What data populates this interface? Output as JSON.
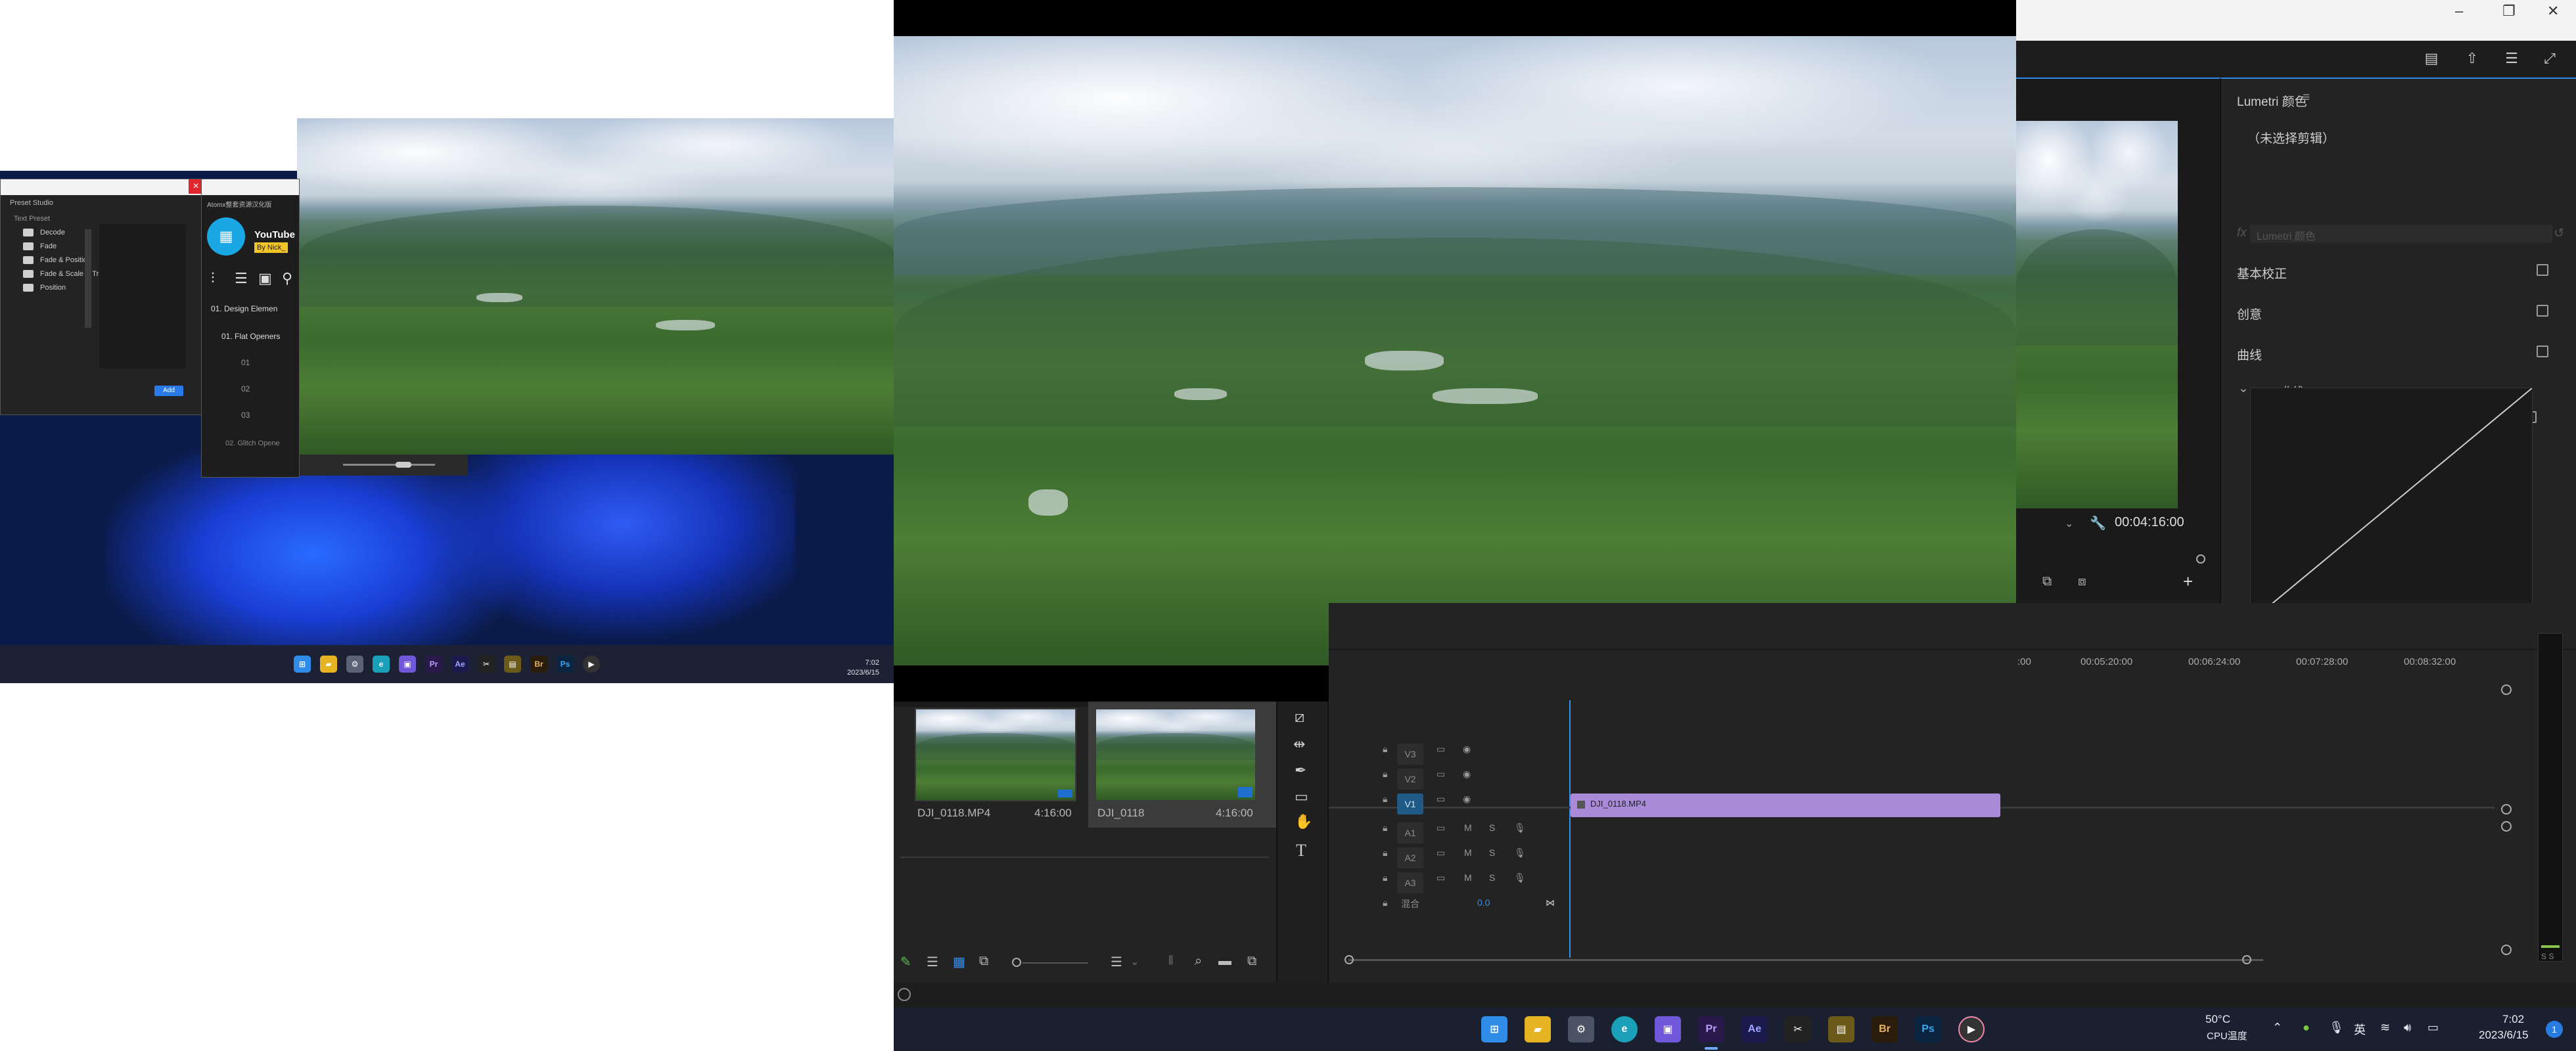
{
  "left_desktop": {
    "preset_panel": {
      "tab_title": "Preset Studio",
      "search_placeholder": "Text Preset",
      "folders": [
        "Decode",
        "Fade",
        "Fade & Position",
        "Fade & Scale & Tracking",
        "Position"
      ],
      "add_label": "Add"
    },
    "atomx_panel": {
      "title": "Atomx整套资源汉化版",
      "product": "YouTube",
      "byline": "By Nick_",
      "items": [
        "01. Design Elemen",
        "01. Flat Openers",
        "01",
        "02",
        "03",
        "02. Glitch Opene"
      ]
    },
    "clock_time": "7:02",
    "clock_date": "2023/6/15"
  },
  "premiere": {
    "lumetri": {
      "title": "Lumetri 颜色",
      "no_clip": "（未选择剪辑）",
      "fx_placeholder": "Lumetri 颜色",
      "sections": [
        "基本校正",
        "创意",
        "曲线"
      ],
      "rgb_curve": "RGB 曲线"
    },
    "program_monitor": {
      "timecode": "00:04:16:00"
    },
    "ruler": [
      "00:05:20:00",
      "00:06:24:00",
      "00:07:28:00",
      "00:08:32:00",
      ":00"
    ],
    "project_items": [
      {
        "name": "DJI_0118.MP4",
        "duration": "4:16:00"
      },
      {
        "name": "DJI_0118",
        "duration": "4:16:00"
      }
    ],
    "tracks": {
      "video": [
        "V3",
        "V2",
        "V1"
      ],
      "audio": [
        "A1",
        "A2",
        "A3"
      ],
      "mix_label": "混合",
      "mix_value": "0.0",
      "mute_label": "M",
      "solo_label": "S",
      "clip_label": "DJI_0118.MP4"
    },
    "audio_meter_label": "S S"
  },
  "taskbar": {
    "temp": "50°C",
    "temp_label": "CPU温度",
    "ime": "英",
    "time": "7:02",
    "date": "2023/6/15",
    "notif_count": "1"
  }
}
